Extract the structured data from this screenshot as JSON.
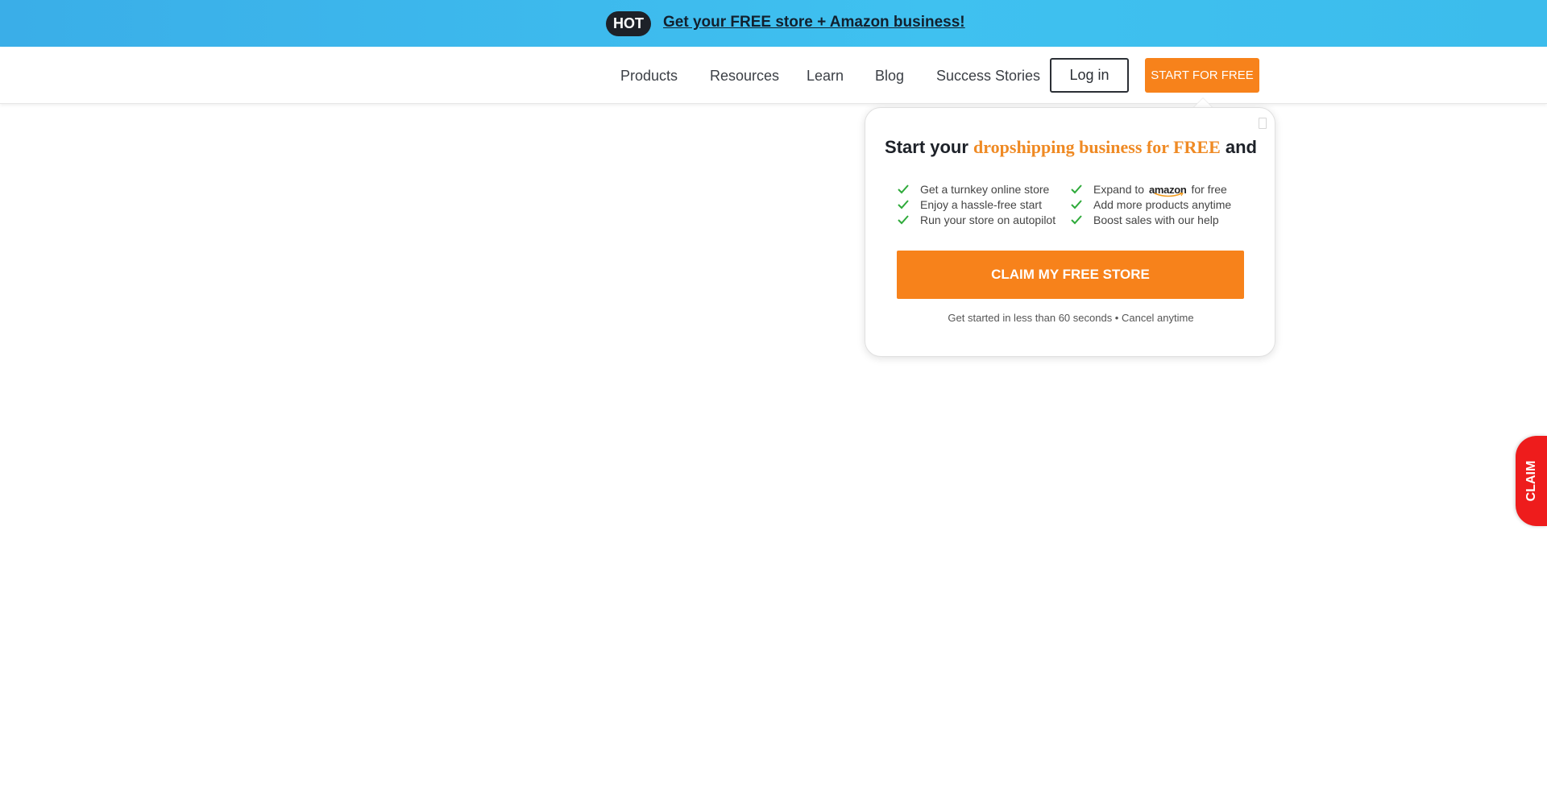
{
  "banner": {
    "badge": "HOT",
    "link_text": "Get your FREE store + Amazon business!"
  },
  "nav": {
    "items": [
      "Products",
      "Resources",
      "Learn",
      "Blog",
      "Success Stories"
    ],
    "login_label": "Log in",
    "cta_label": "START FOR FREE"
  },
  "popup": {
    "title_prefix": "Start your ",
    "title_highlight": "dropshipping business for FREE",
    "title_suffix": " and",
    "features_left": [
      "Get a turnkey online store",
      "Enjoy a hassle-free start",
      "Run your store on autopilot"
    ],
    "feature_right_1_prefix": "Expand to",
    "feature_right_1_logo": "amazon",
    "feature_right_1_suffix": "for free",
    "features_right_rest": [
      "Add more products anytime",
      "Boost sales with our help"
    ],
    "cta_label": "CLAIM MY FREE STORE",
    "footnote": "Get started in less than 60 seconds • Cancel anytime"
  },
  "side_tab": {
    "label": "CLAIM"
  },
  "colors": {
    "accent": "#f7821b",
    "banner": "#3fc1f0",
    "check": "#2eaa3a",
    "claim_tab": "#ee1c1c"
  }
}
